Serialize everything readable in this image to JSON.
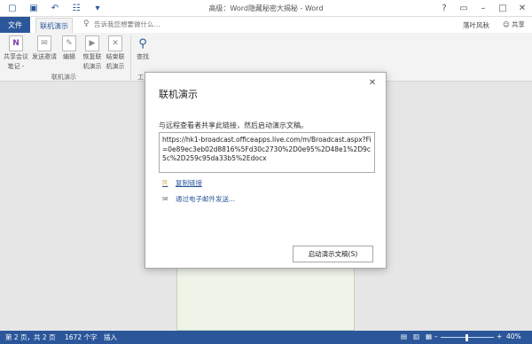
{
  "window": {
    "title": "高级​：Word隐藏秘密大揭秘 - Word",
    "user": "落叶风秋",
    "share_label": "共享"
  },
  "tabs": {
    "file": "文件",
    "broadcast": "联机演示"
  },
  "tell_me": {
    "placeholder": "告诉我您想要做什么..."
  },
  "ribbon": {
    "buttons": [
      {
        "label1": "共享会议",
        "label2": "笔记 -",
        "icon": "onenote-icon"
      },
      {
        "label1": "发送邀请",
        "label2": "",
        "icon": "send-invite-icon"
      },
      {
        "label1": "编辑",
        "label2": "",
        "icon": "edit-icon"
      },
      {
        "label1": "恢复联",
        "label2": "机演示",
        "icon": "resume-icon"
      },
      {
        "label1": "结束联",
        "label2": "机演示",
        "icon": "end-icon"
      },
      {
        "label1": "查找",
        "label2": "",
        "icon": "find-icon"
      }
    ],
    "group_label": "联机演示",
    "group2_label": "工"
  },
  "dialog": {
    "title": "联机演示",
    "description": "与远程查看者共享此链接，然后启动演示文稿。",
    "url": "https://hk1-broadcast.officeapps.live.com/m/Broadcast.aspx?Fi=0e89ec3eb02d8816%5Fd30c2730%2D0e95%2D48e1%2D9c5c%2D259c95da33b5%2Edocx",
    "copy_link": "复制链接",
    "email_link": "通过电子邮件发送...",
    "start_button": "启动演示文稿(S)"
  },
  "status": {
    "page": "第 2 页，共 2 页",
    "words": "1672 个字",
    "mode": "插入",
    "zoom": "40%"
  },
  "colors": {
    "accent": "#2b579a"
  }
}
